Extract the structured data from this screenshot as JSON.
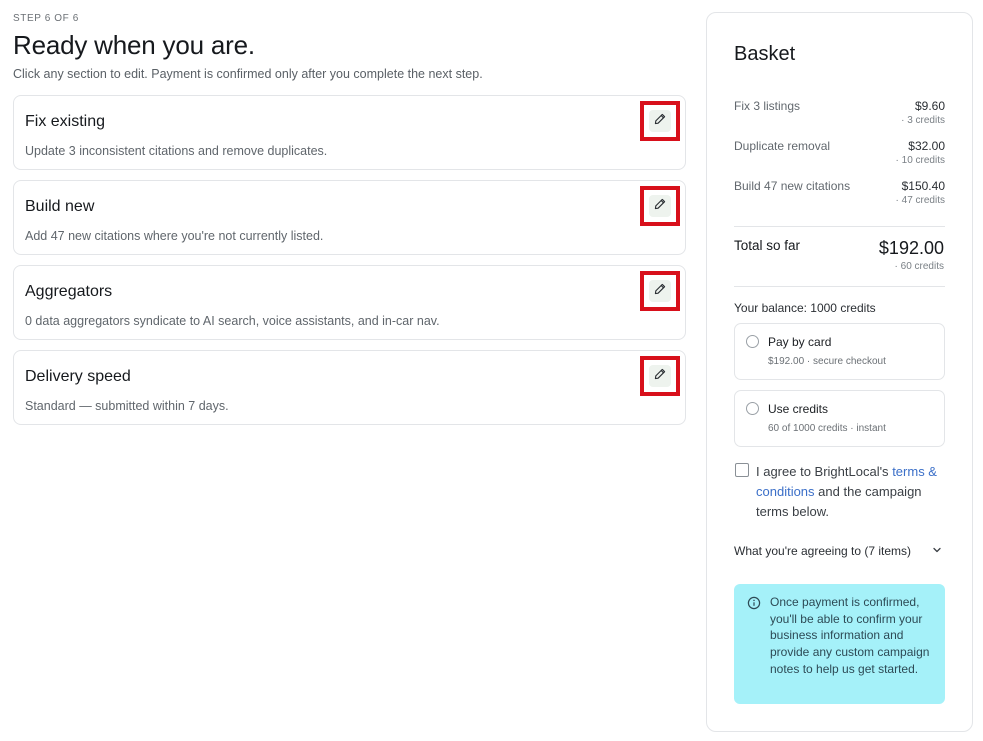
{
  "header": {
    "step": "STEP 6 OF 6",
    "title": "Ready when you are.",
    "subtitle": "Click any section to edit. Payment is confirmed only after you complete the next step."
  },
  "sections": [
    {
      "title": "Fix existing",
      "desc": "Update 3 inconsistent citations and remove duplicates.",
      "icon": "pencil-icon"
    },
    {
      "title": "Build new",
      "desc": "Add 47 new citations where you're not currently listed.",
      "icon": "pencil-icon"
    },
    {
      "title": "Aggregators",
      "desc": "0 data aggregators syndicate to AI search, voice assistants, and in-car nav.",
      "icon": "pencil-icon"
    },
    {
      "title": "Delivery speed",
      "desc": "Standard — submitted within 7 days.",
      "icon": "pencil-icon"
    }
  ],
  "basket": {
    "title": "Basket",
    "lines": [
      {
        "label": "Fix 3 listings",
        "price": "$9.60",
        "credits": "· 3 credits"
      },
      {
        "label": "Duplicate removal",
        "price": "$32.00",
        "credits": "· 10 credits"
      },
      {
        "label": "Build 47 new citations",
        "price": "$150.40",
        "credits": "· 47 credits"
      }
    ],
    "total_label": "Total so far",
    "total_amount": "$192.00",
    "total_credits": "· 60 credits",
    "balance": "Your balance: 1000 credits",
    "options": [
      {
        "title": "Pay by card",
        "sub": "$192.00 · secure checkout"
      },
      {
        "title": "Use credits",
        "sub": "60 of 1000 credits · instant"
      }
    ],
    "agree_prefix": "I agree to BrightLocal's",
    "agree_link": "terms & conditions",
    "agree_suffix": "and the campaign terms below.",
    "agreeing_label": "What you're agreeing to (7 items)",
    "info_text": "Once payment is confirmed, you'll be able to confirm your business information and provide any custom campaign notes to help us get started."
  },
  "colors": {
    "accent_link": "#3b6fc8",
    "highlight_border": "#d8101b",
    "info_bg": "#a5f1f9",
    "edit_button_bg": "#eef3ee"
  }
}
